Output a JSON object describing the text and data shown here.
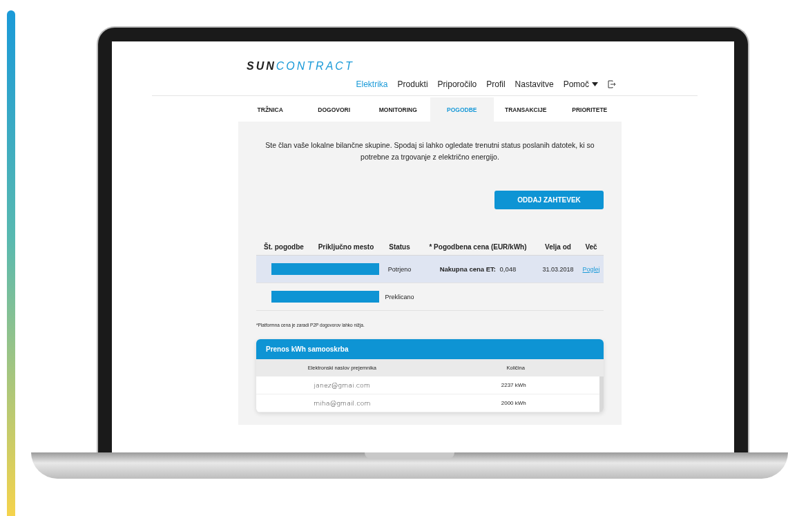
{
  "logo": {
    "dark": "SUN",
    "accent": "CONTRACT"
  },
  "nav": [
    {
      "label": "Elektrika",
      "selected": true,
      "has_menu": false
    },
    {
      "label": "Produkti",
      "selected": false,
      "has_menu": false
    },
    {
      "label": "Priporočilo",
      "selected": false,
      "has_menu": false
    },
    {
      "label": "Profil",
      "selected": false,
      "has_menu": false
    },
    {
      "label": "Nastavitve",
      "selected": false,
      "has_menu": false
    },
    {
      "label": "Pomoč",
      "selected": false,
      "has_menu": true
    }
  ],
  "tabs": [
    {
      "label": "TRŽNICA",
      "selected": false
    },
    {
      "label": "DOGOVORI",
      "selected": false
    },
    {
      "label": "MONITORING",
      "selected": false
    },
    {
      "label": "POGODBE",
      "selected": true
    },
    {
      "label": "TRANSAKCIJE",
      "selected": false
    },
    {
      "label": "PRIORITETE",
      "selected": false
    }
  ],
  "intro": "Ste član vaše lokalne bilančne skupine. Spodaj si lahko ogledate trenutni status poslanih datotek, ki so potrebne za trgovanje z električno energijo.",
  "request_button": "ODDAJ ZAHTEVEK",
  "contracts": {
    "columns": [
      "Št. pogodbe",
      "Priključno mesto",
      "Status",
      "* Pogodbena cena (EUR/kWh)",
      "Velja od",
      "Več"
    ],
    "rows": [
      {
        "selected": true,
        "status": "Potrjeno",
        "price_label": "Nakupna cena ET:",
        "price": "0,048",
        "valid_from": "31.03.2018",
        "link": "Poglej"
      },
      {
        "selected": false,
        "status": "Preklicano"
      }
    ]
  },
  "footnote": "*Platformna cena je zaradi P2P dogovorov lahko nižja.",
  "transfer": {
    "title": "Prenos kWh samooskrba",
    "columns": [
      "Elektronski naslov prejemnika",
      "Količina"
    ],
    "rows": [
      {
        "email": "janez@gmai.com",
        "amount": "2237 kWh"
      },
      {
        "email": "miha@gmail.com",
        "amount": "2000 kWh"
      }
    ]
  }
}
